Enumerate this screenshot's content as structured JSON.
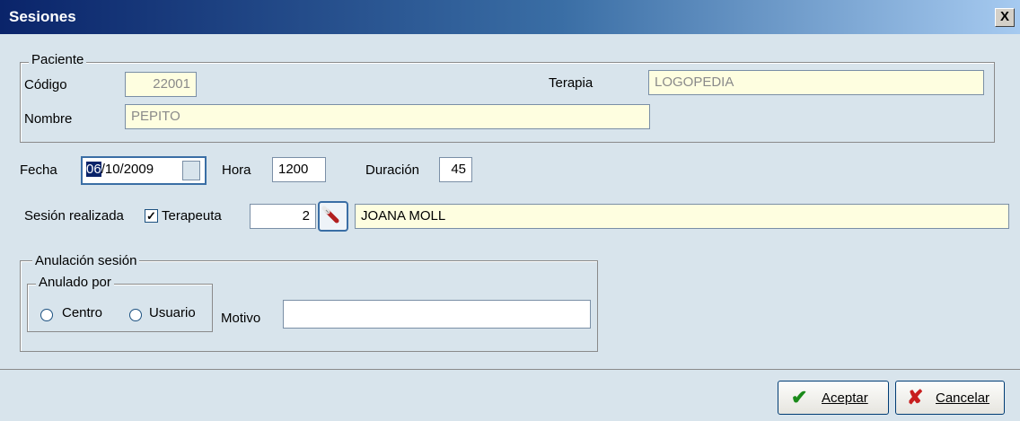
{
  "window": {
    "title": "Sesiones",
    "close_glyph": "X"
  },
  "paciente": {
    "legend": "Paciente",
    "codigo_label": "Código",
    "codigo_value": "22001",
    "terapia_label": "Terapia",
    "terapia_value": "LOGOPEDIA",
    "nombre_label": "Nombre",
    "nombre_value": "PEPITO"
  },
  "fecha": {
    "label": "Fecha",
    "value_selected": "06",
    "value_rest": "/10/2009"
  },
  "hora": {
    "label": "Hora",
    "value": "1200"
  },
  "duracion": {
    "label": "Duración",
    "value": "45"
  },
  "sesion_realizada": {
    "label": "Sesión realizada",
    "checked": true
  },
  "terapeuta": {
    "label": "Terapeuta",
    "id": "2",
    "name": "JOANA MOLL",
    "lookup_icon": "eraser-icon"
  },
  "anulacion": {
    "legend": "Anulación sesión",
    "anulado_por": {
      "legend": "Anulado por",
      "options": [
        "Centro",
        "Usuario"
      ]
    },
    "motivo_label": "Motivo",
    "motivo_value": ""
  },
  "buttons": {
    "aceptar_label": "Aceptar",
    "cancelar_label": "Cancelar"
  },
  "colors": {
    "accent": "#0a246a",
    "readonly_bg": "#fefee0",
    "window_bg": "#d8e4ec",
    "ok_green": "#1a8a1a",
    "cancel_red": "#c81e1e"
  }
}
